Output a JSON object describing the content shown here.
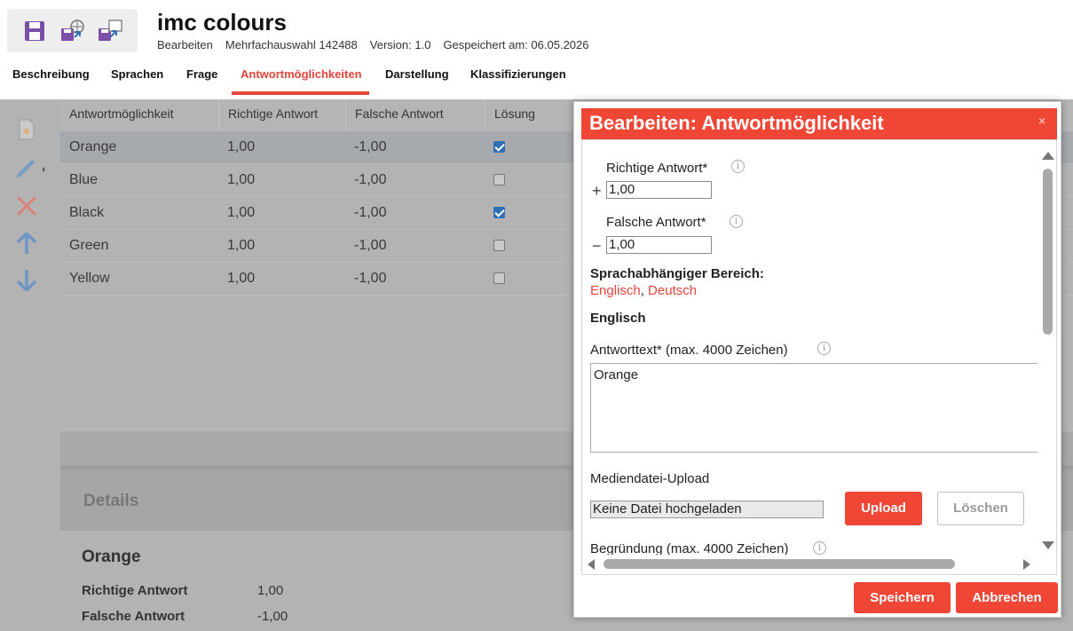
{
  "header": {
    "title": "imc colours",
    "meta": [
      "Bearbeiten",
      "Mehrfachauswahl 142488",
      "Version: 1.0",
      "Gespeichert am: 06.05.2026"
    ],
    "toolbar_icons": [
      "save-icon",
      "save-publish-icon",
      "save-as-icon"
    ]
  },
  "tabs": [
    {
      "label": "Beschreibung",
      "active": false
    },
    {
      "label": "Sprachen",
      "active": false
    },
    {
      "label": "Frage",
      "active": false
    },
    {
      "label": "Antwortmöglichkeiten",
      "active": true
    },
    {
      "label": "Darstellung",
      "active": false
    },
    {
      "label": "Klassifizierungen",
      "active": false
    }
  ],
  "accent_color": "#e8453c",
  "leftbar_icons": [
    "new-icon",
    "edit-icon",
    "delete-icon",
    "move-up-icon",
    "move-down-icon"
  ],
  "grid": {
    "columns": [
      "Antwortmöglichkeit",
      "Richtige Antwort",
      "Falsche Antwort",
      "Lösung"
    ],
    "rows": [
      {
        "name": "Orange",
        "correct": "1,00",
        "wrong": "-1,00",
        "solution": true,
        "selected": true
      },
      {
        "name": "Blue",
        "correct": "1,00",
        "wrong": "-1,00",
        "solution": false,
        "selected": false
      },
      {
        "name": "Black",
        "correct": "1,00",
        "wrong": "-1,00",
        "solution": true,
        "selected": false
      },
      {
        "name": "Green",
        "correct": "1,00",
        "wrong": "-1,00",
        "solution": false,
        "selected": false
      },
      {
        "name": "Yellow",
        "correct": "1,00",
        "wrong": "-1,00",
        "solution": false,
        "selected": false
      }
    ]
  },
  "details": {
    "heading": "Details",
    "name": "Orange",
    "fields": [
      {
        "label": "Richtige Antwort",
        "value": "1,00"
      },
      {
        "label": "Falsche Antwort",
        "value": "-1,00"
      }
    ]
  },
  "modal": {
    "title": "Bearbeiten: Antwortmöglichkeit",
    "close": "×",
    "correct_label": "Richtige Antwort*",
    "correct_value": "1,00",
    "wrong_label": "Falsche Antwort*",
    "wrong_value": "1,00",
    "plus": "+",
    "minus": "−",
    "lang_section_label": "Sprachabhängiger Bereich:",
    "languages": [
      "Englisch",
      "Deutsch"
    ],
    "lang_separator": ",",
    "current_language": "Englisch",
    "answer_text_label": "Antworttext* (max. 4000 Zeichen)",
    "answer_text_value": "Orange",
    "media_label": "Mediendatei-Upload",
    "no_file": "Keine Datei hochgeladen",
    "upload_button": "Upload",
    "delete_button": "Löschen",
    "reason_label": "Begründung (max. 4000 Zeichen)",
    "info": "i",
    "save_button": "Speichern",
    "cancel_button": "Abbrechen"
  }
}
